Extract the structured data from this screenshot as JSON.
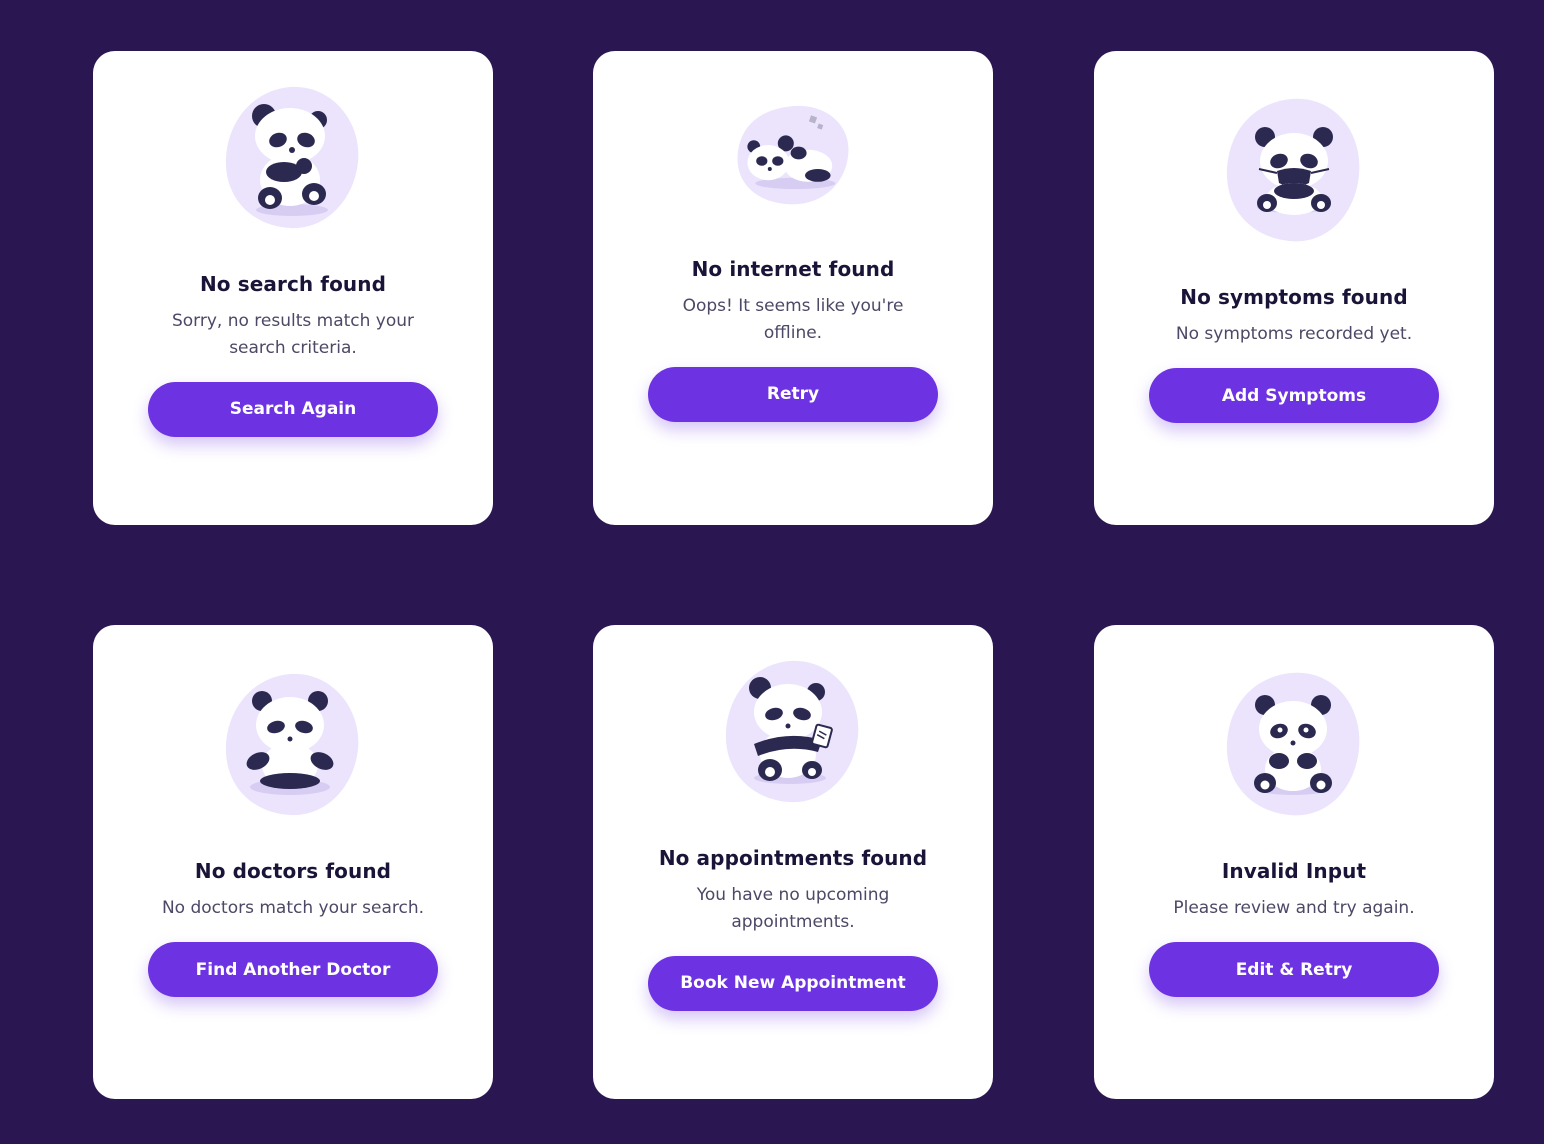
{
  "cards": [
    {
      "illustration": "panda-thinking",
      "title": "No search found",
      "description": "Sorry, no results match your search criteria.",
      "button": "Search Again"
    },
    {
      "illustration": "panda-sleeping",
      "title": "No internet found",
      "description": "Oops! It seems like you're offline.",
      "button": "Retry"
    },
    {
      "illustration": "panda-masked",
      "title": "No symptoms found",
      "description": "No symptoms recorded yet.",
      "button": "Add Symptoms"
    },
    {
      "illustration": "panda-meditating",
      "title": "No doctors found",
      "description": "No doctors match your search.",
      "button": "Find Another Doctor"
    },
    {
      "illustration": "panda-holding-note",
      "title": "No appointments found",
      "description": "You have no upcoming appointments.",
      "button": "Book New Appointment"
    },
    {
      "illustration": "panda-sitting",
      "title": "Invalid Input",
      "description": "Please review and try again.",
      "button": "Edit & Retry"
    }
  ],
  "colors": {
    "background": "#2a1650",
    "card": "#ffffff",
    "accent": "#6d33e2",
    "illustration_blob": "#ebe4fc",
    "panda_dark": "#2b2950",
    "title_text": "#1a1538",
    "body_text": "#4c4866"
  }
}
